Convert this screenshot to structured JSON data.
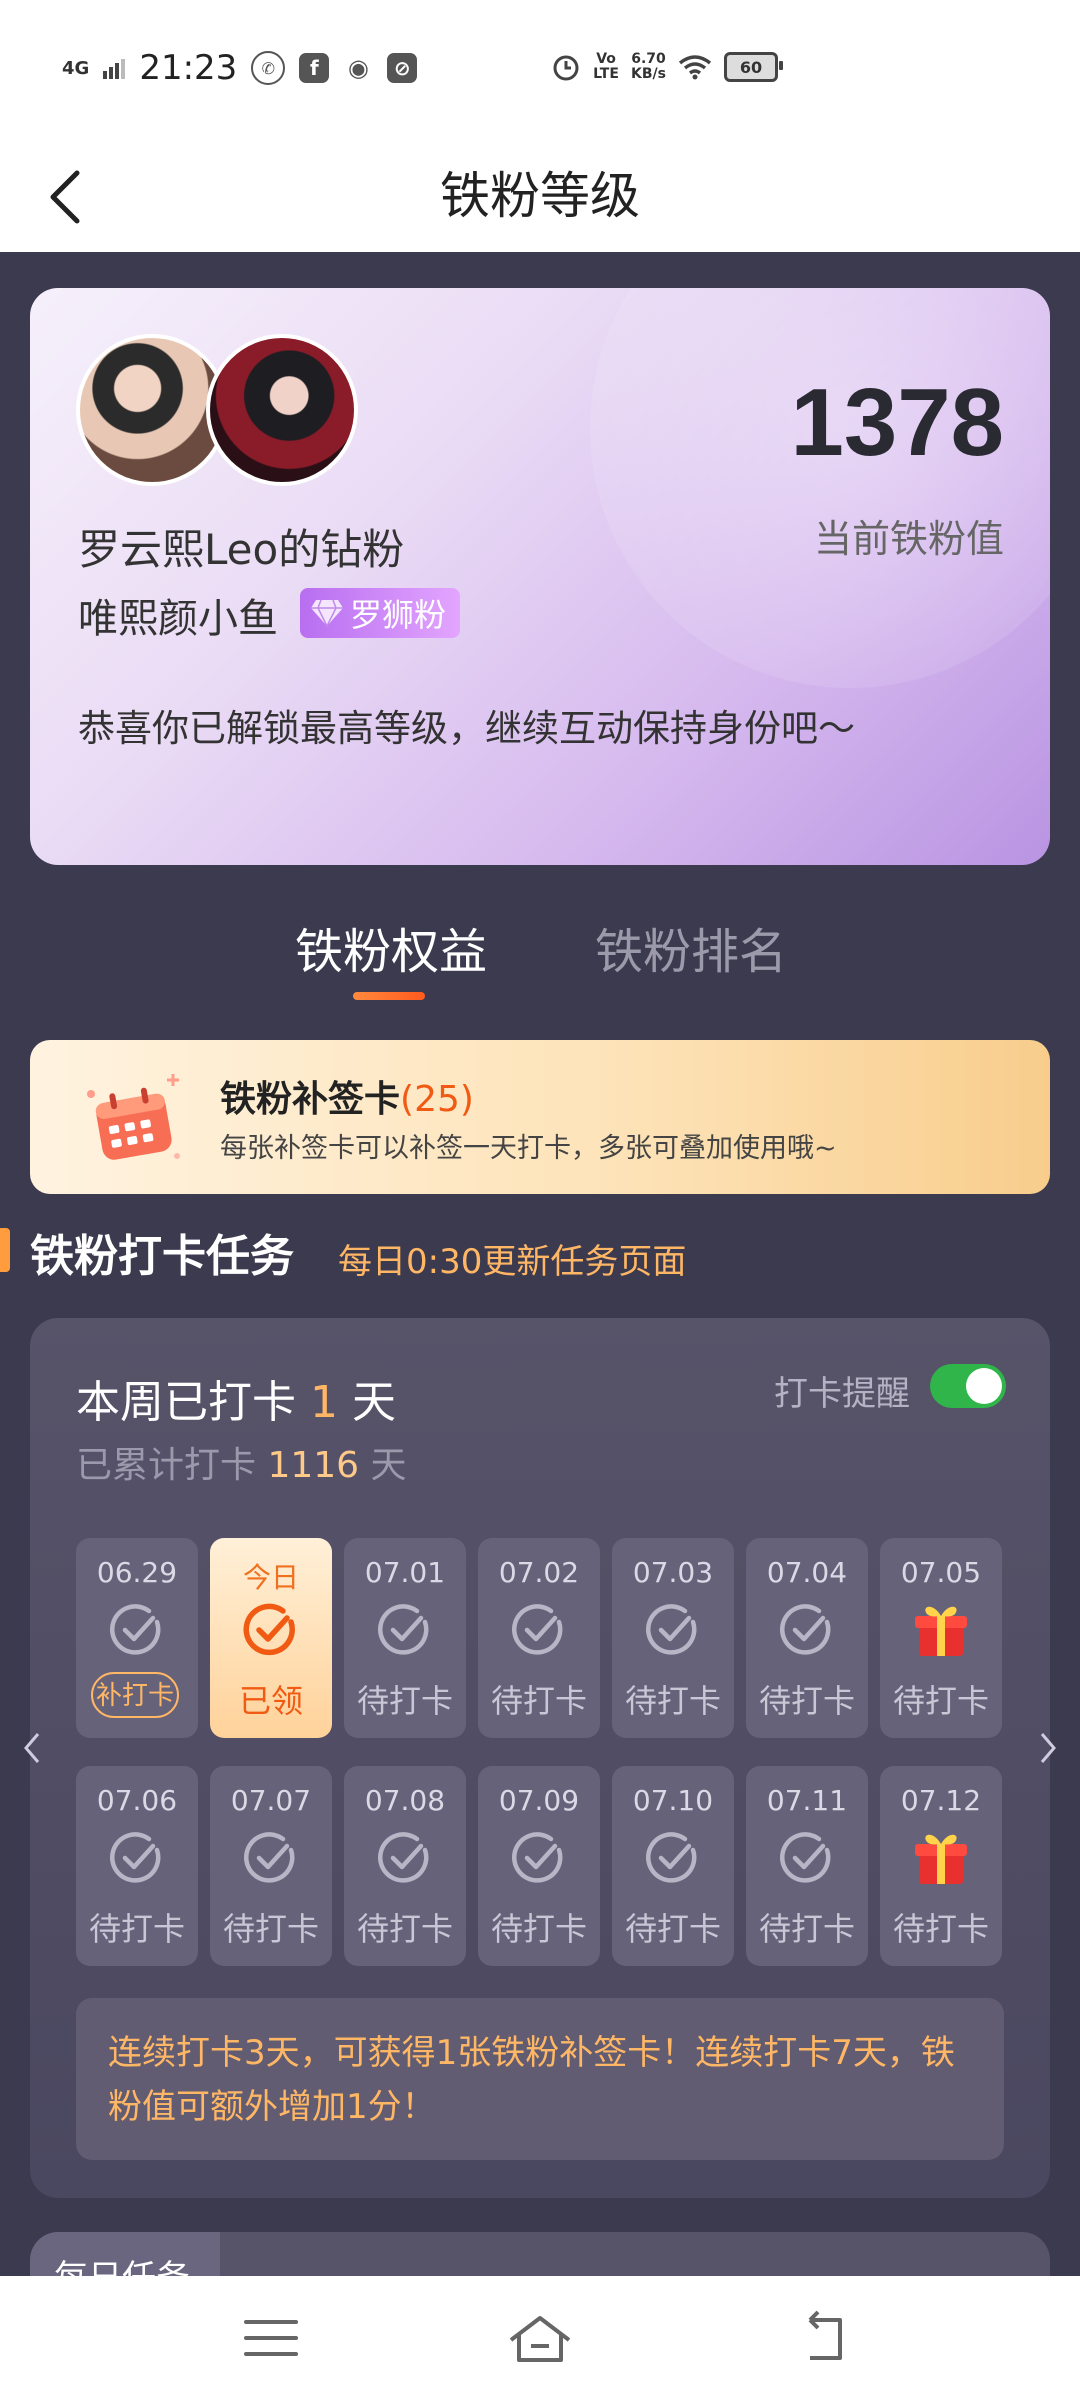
{
  "status_bar": {
    "network": "4G",
    "time": "21:23",
    "volte": "Vo LTE",
    "speed": "6.70",
    "speed_unit": "KB/s",
    "battery": "60"
  },
  "header": {
    "title": "铁粉等级"
  },
  "profile": {
    "fan_title": "罗云熙Leo的钻粉",
    "username": "唯熙颜小鱼",
    "badge": "罗狮粉",
    "score": "1378",
    "score_label": "当前铁粉值",
    "message": "恭喜你已解锁最高等级，继续互动保持身份吧～"
  },
  "tabs": [
    {
      "label": "铁粉权益",
      "active": true
    },
    {
      "label": "铁粉排名",
      "active": false
    }
  ],
  "supplement_card": {
    "title": "铁粉补签卡",
    "count_open": "(",
    "count": "25",
    "count_close": ")",
    "description": "每张补签卡可以补签一天打卡，多张可叠加使用哦~"
  },
  "checkin_section": {
    "title": "铁粉打卡任务",
    "subtitle": "每日0:30更新任务页面"
  },
  "checkin": {
    "week_prefix": "本周已打卡",
    "week_days": "1",
    "week_suffix": "天",
    "total_prefix": "已累计打卡",
    "total_days": "1116",
    "total_suffix": "天",
    "reminder_label": "打卡提醒",
    "reminder_on": true,
    "days": [
      {
        "date": "06.29",
        "status": "补打卡",
        "icon": "check-icon",
        "style": "pill"
      },
      {
        "date": "今日",
        "status": "已领",
        "icon": "check-done-icon",
        "style": "today"
      },
      {
        "date": "07.01",
        "status": "待打卡",
        "icon": "check-icon",
        "style": "normal"
      },
      {
        "date": "07.02",
        "status": "待打卡",
        "icon": "check-icon",
        "style": "normal"
      },
      {
        "date": "07.03",
        "status": "待打卡",
        "icon": "check-icon",
        "style": "normal"
      },
      {
        "date": "07.04",
        "status": "待打卡",
        "icon": "check-icon",
        "style": "normal"
      },
      {
        "date": "07.05",
        "status": "待打卡",
        "icon": "gift-icon",
        "style": "normal"
      },
      {
        "date": "07.06",
        "status": "待打卡",
        "icon": "check-icon",
        "style": "normal"
      },
      {
        "date": "07.07",
        "status": "待打卡",
        "icon": "check-icon",
        "style": "normal"
      },
      {
        "date": "07.08",
        "status": "待打卡",
        "icon": "check-icon",
        "style": "normal"
      },
      {
        "date": "07.09",
        "status": "待打卡",
        "icon": "check-icon",
        "style": "normal"
      },
      {
        "date": "07.10",
        "status": "待打卡",
        "icon": "check-icon",
        "style": "normal"
      },
      {
        "date": "07.11",
        "status": "待打卡",
        "icon": "check-icon",
        "style": "normal"
      },
      {
        "date": "07.12",
        "status": "待打卡",
        "icon": "gift-icon",
        "style": "normal"
      }
    ],
    "reward_tip": "连续打卡3天，可获得1张铁粉补签卡！连续打卡7天，铁粉值可额外增加1分！"
  },
  "daily_tasks": {
    "label": "每日任务"
  },
  "colors": {
    "background": "#3c3a4e",
    "accent_orange": "#f05a12",
    "highlight": "#ffb766",
    "toggle_on": "#2fb54a"
  }
}
